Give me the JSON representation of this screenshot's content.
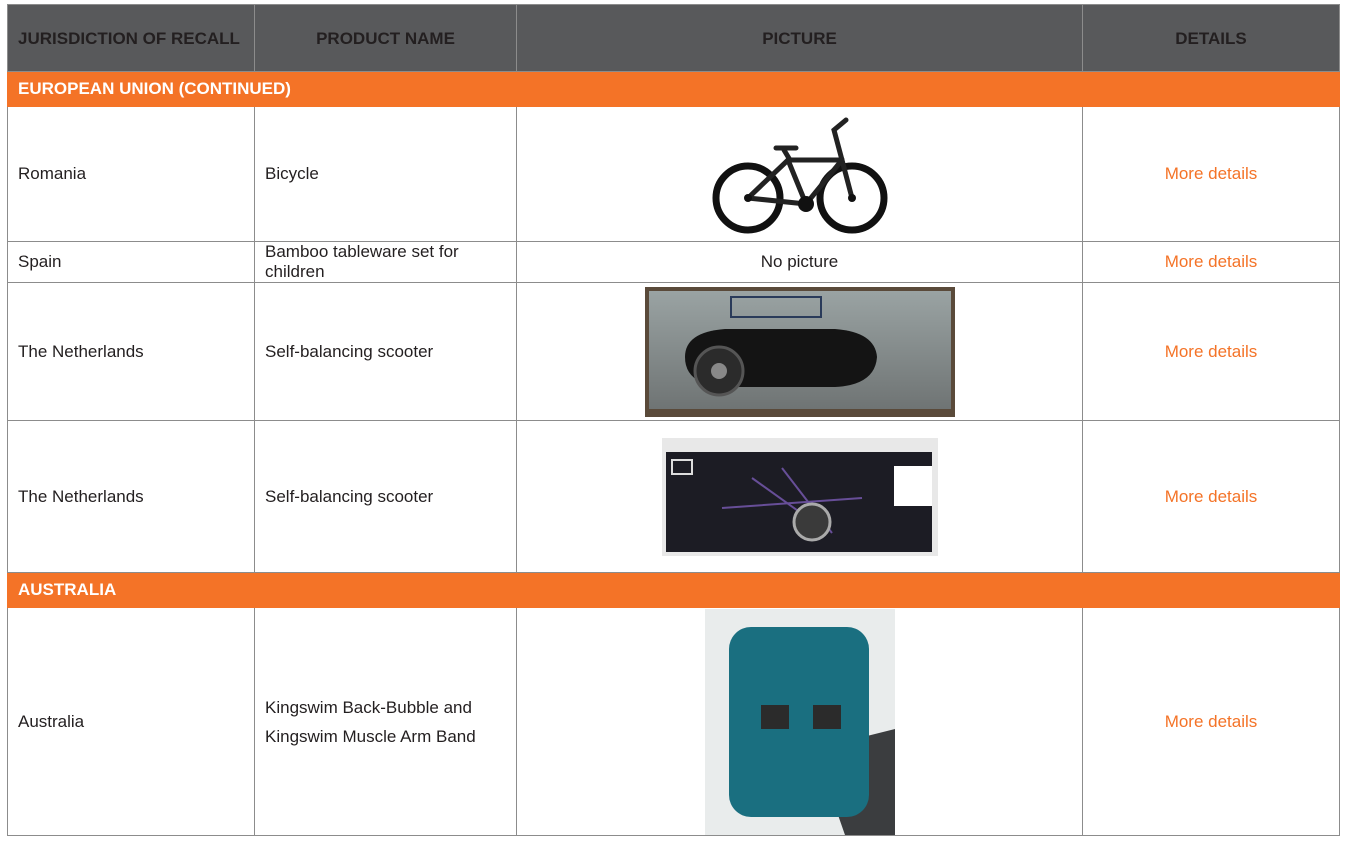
{
  "headers": {
    "jurisdiction": "JURISDICTION OF RECALL",
    "product": "PRODUCT NAME",
    "picture": "PICTURE",
    "details": "DETAILS"
  },
  "sections": [
    {
      "title": "EUROPEAN UNION (CONTINUED)",
      "rows": [
        {
          "jurisdiction": "Romania",
          "product": "Bicycle",
          "picture_text": "",
          "picture_icon": "bicycle-image",
          "details": "More details"
        },
        {
          "jurisdiction": "Spain",
          "product": "Bamboo tableware set for children",
          "picture_text": "No picture",
          "picture_icon": "",
          "details": "More details"
        },
        {
          "jurisdiction": "The Netherlands",
          "product": "Self-balancing scooter",
          "picture_text": "",
          "picture_icon": "hoverboard-box-image",
          "details": "More details"
        },
        {
          "jurisdiction": "The Netherlands",
          "product": "Self-balancing scooter",
          "picture_text": "",
          "picture_icon": "hoverboard-box-image",
          "details": "More details"
        }
      ]
    },
    {
      "title": "AUSTRALIA",
      "rows": [
        {
          "jurisdiction": "Australia",
          "product": "Kingswim Back-Bubble and Kingswim Muscle Arm Band",
          "picture_text": "",
          "picture_icon": "swim-float-image",
          "details": "More details"
        }
      ]
    }
  ],
  "colors": {
    "header_bg": "#58595b",
    "section_bg": "#f47327",
    "link": "#f47327",
    "border": "#8c8c8c"
  }
}
